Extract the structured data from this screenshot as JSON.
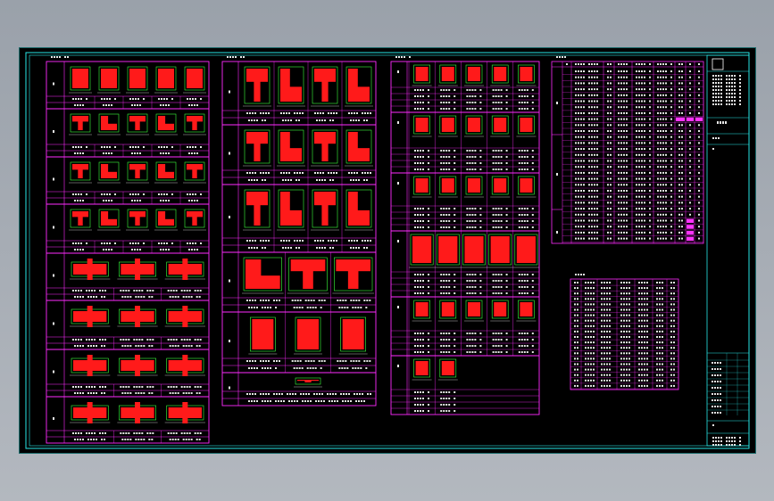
{
  "app": {
    "title": "",
    "background_color": "#a3a9b1"
  },
  "drawing": {
    "sheet_color": "#000000",
    "colors": {
      "frame": "#29e6e6",
      "table": "#ff2bff",
      "text": "#e6e6e6",
      "section_fill": "#ff1a1a",
      "rebar": "#3cff3c",
      "highlight": "#ff33ff",
      "title_block": "#ffffff"
    },
    "panel_labels": [
      "",
      "",
      "",
      "",
      ""
    ],
    "title_block_text": [
      "",
      "",
      "",
      ""
    ],
    "icons": [
      "grid-icon",
      "title-block-icon"
    ]
  }
}
